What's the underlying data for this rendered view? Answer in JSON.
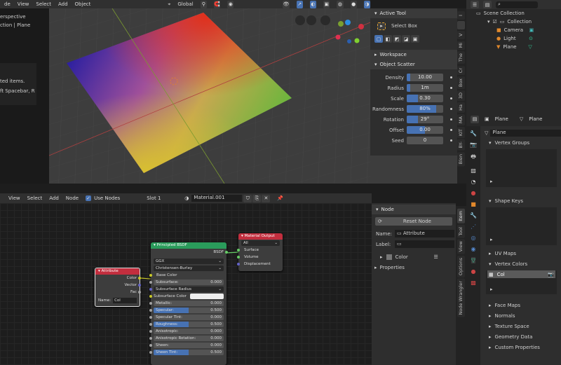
{
  "viewport": {
    "menu": [
      "de",
      "View",
      "Select",
      "Add",
      "Object"
    ],
    "transform": "Global",
    "overlay_text": [
      "erspective",
      "ction | Plane"
    ],
    "info_text": [
      "ted items.",
      "ft Spacebar, R"
    ],
    "gizmo": {
      "x": "X",
      "y": "Y",
      "z": "Z"
    }
  },
  "n_panel": {
    "active_tool_title": "Active Tool",
    "tool_name": "Select Box",
    "workspace": "Workspace",
    "scatter_title": "Object Scatter",
    "fields": [
      {
        "label": "Density",
        "value": "10.00",
        "fill": 0.1
      },
      {
        "label": "Radius",
        "value": "1m",
        "fill": 0.1
      },
      {
        "label": "Scale",
        "value": "0.30",
        "fill": 0.3
      },
      {
        "label": "Randomness",
        "value": "80%",
        "fill": 0.8
      },
      {
        "label": "Rotation",
        "value": "29°",
        "fill": 0.3
      },
      {
        "label": "Offset",
        "value": "0.00",
        "fill": 0.5
      },
      {
        "label": "Seed",
        "value": "0",
        "fill": 0
      }
    ],
    "tabs": [
      "I",
      "",
      "V",
      "Mi",
      "The",
      "Cr",
      "Box",
      "3D",
      "Ha",
      "MA",
      "KIT",
      "BY-",
      "Blen"
    ]
  },
  "outliner": {
    "scene": "Scene Collection",
    "collection": "Collection",
    "items": [
      "Camera",
      "Light",
      "Plane"
    ]
  },
  "properties": {
    "object": "Plane",
    "mesh": "Plane",
    "datablock": "Plane",
    "vertex_groups": "Vertex Groups",
    "shape_keys": "Shape Keys",
    "uv_maps": "UV Maps",
    "vertex_colors": "Vertex Colors",
    "vc_item": "Col",
    "sections": [
      "Face Maps",
      "Normals",
      "Texture Space",
      "Geometry Data",
      "Custom Properties"
    ]
  },
  "node_editor": {
    "menu": [
      "View",
      "Select",
      "Add",
      "Node"
    ],
    "use_nodes": "Use Nodes",
    "slot": "Slot 1",
    "material": "Material.001",
    "attribute": {
      "title": "Attribute",
      "outputs": [
        "Color",
        "Vector",
        "Fac"
      ],
      "name_label": "Name:",
      "name_value": "Col"
    },
    "bsdf": {
      "title": "Principled BSDF",
      "output": "BSDF",
      "dist": "GGX",
      "sss": "Christensen-Burley",
      "base_color": "Base Color",
      "fields": [
        {
          "label": "Subsurface:",
          "value": "0.000",
          "fill": 0
        },
        {
          "label": "Subsurface Radius",
          "value": "",
          "fill": 0
        },
        {
          "label": "Subsurface Color",
          "value": "",
          "fill": 0
        },
        {
          "label": "Metallic:",
          "value": "0.000",
          "fill": 0
        },
        {
          "label": "Specular:",
          "value": "0.500",
          "fill": 0.5
        },
        {
          "label": "Specular Tint:",
          "value": "0.000",
          "fill": 0
        },
        {
          "label": "Roughness:",
          "value": "0.500",
          "fill": 0.5
        },
        {
          "label": "Anisotropic:",
          "value": "0.000",
          "fill": 0
        },
        {
          "label": "Anisotropic Rotation:",
          "value": "0.000",
          "fill": 0
        },
        {
          "label": "Sheen:",
          "value": "0.000",
          "fill": 0
        },
        {
          "label": "Sheen Tint:",
          "value": "0.500",
          "fill": 0.5
        }
      ]
    },
    "output": {
      "title": "Material Output",
      "target": "All",
      "inputs": [
        "Surface",
        "Volume",
        "Displacement"
      ]
    }
  },
  "node_sidebar": {
    "title": "Node",
    "reset": "Reset Node",
    "name_label": "Name:",
    "name_value": "Attribute",
    "label_label": "Label:",
    "color": "Color",
    "properties": "Properties",
    "tabs": [
      "Item",
      "Tool",
      "View",
      "Options",
      "Node Wrangler"
    ]
  }
}
